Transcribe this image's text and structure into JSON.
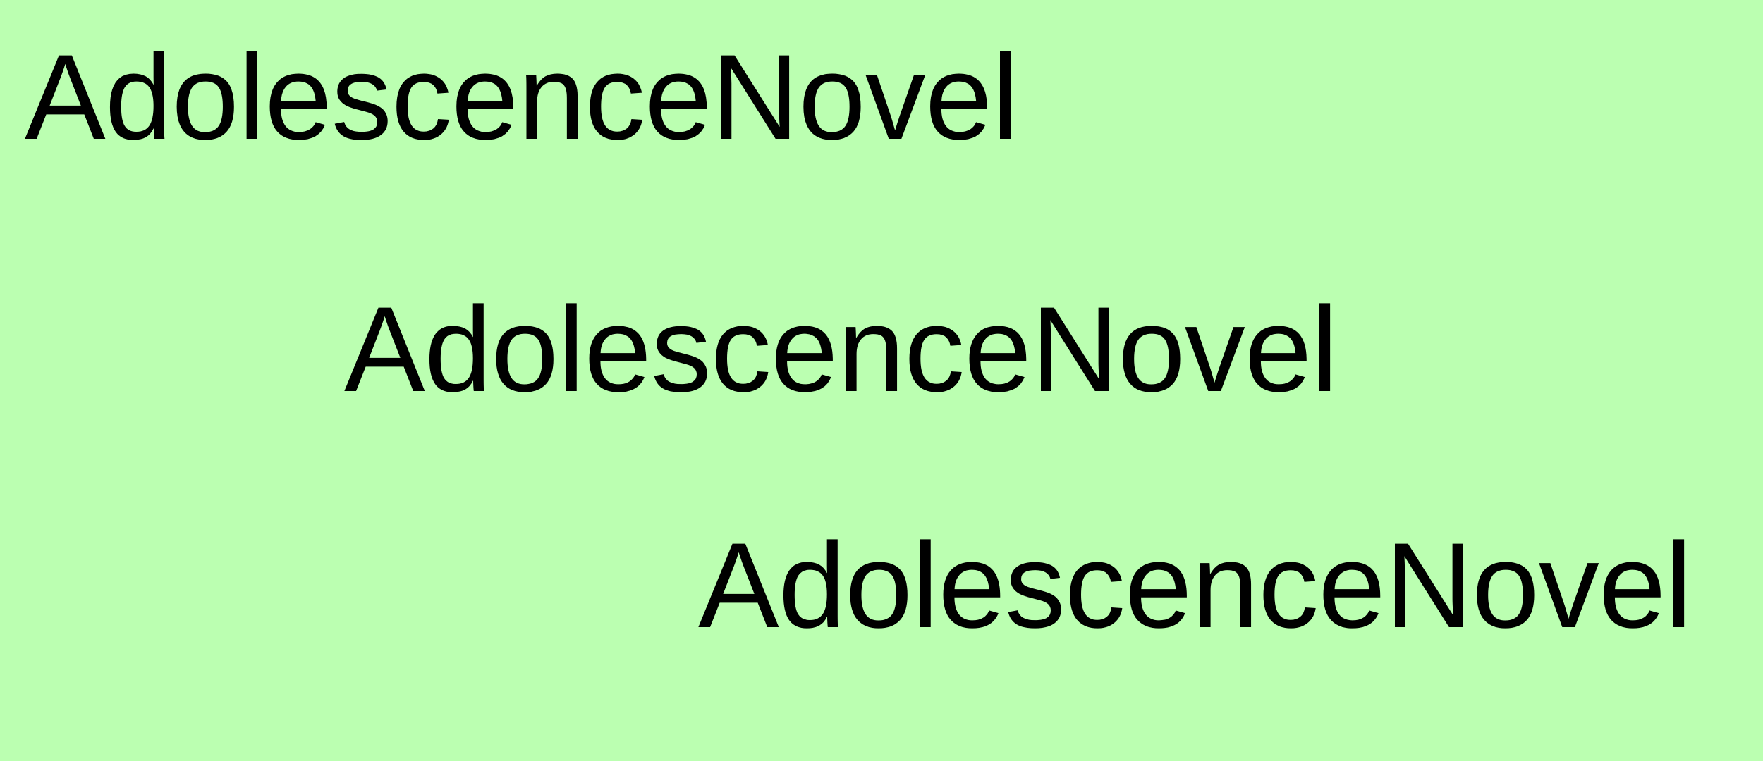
{
  "background_color": "#bbffb1",
  "text_color": "#000000",
  "lines": [
    "AdolescenceNovel",
    "AdolescenceNovel",
    "AdolescenceNovel"
  ]
}
